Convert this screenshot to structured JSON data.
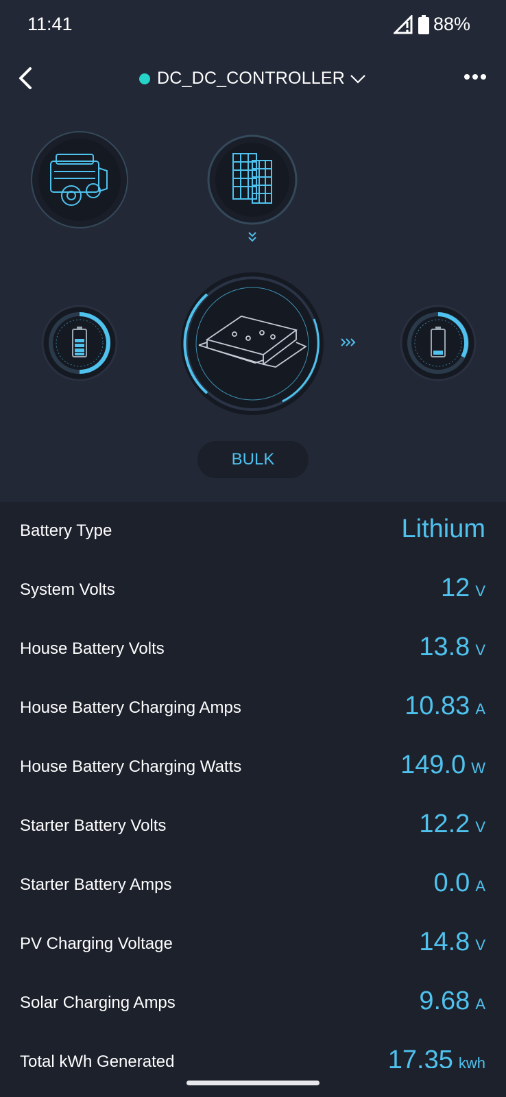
{
  "status_bar": {
    "time": "11:41",
    "battery": "88%"
  },
  "header": {
    "device_name": "DC_DC_CONTROLLER"
  },
  "mode": "BULK",
  "colors": {
    "accent": "#4fc2ee",
    "online_dot": "#26d3c8",
    "background": "#1d212c",
    "panel": "#232836"
  },
  "rows": [
    {
      "label": "Battery Type",
      "value": "Lithium",
      "unit": ""
    },
    {
      "label": "System Volts",
      "value": "12",
      "unit": "V"
    },
    {
      "label": "House Battery Volts",
      "value": "13.8",
      "unit": "V"
    },
    {
      "label": "House Battery Charging Amps",
      "value": "10.83",
      "unit": "A"
    },
    {
      "label": "House Battery Charging Watts",
      "value": "149.0",
      "unit": "W"
    },
    {
      "label": "Starter Battery Volts",
      "value": "12.2",
      "unit": "V"
    },
    {
      "label": "Starter Battery Amps",
      "value": "0.0",
      "unit": "A"
    },
    {
      "label": "PV Charging Voltage",
      "value": "14.8",
      "unit": "V"
    },
    {
      "label": "Solar Charging Amps",
      "value": "9.68",
      "unit": "A"
    },
    {
      "label": "Total kWh Generated",
      "value": "17.35",
      "unit": "kwh"
    }
  ]
}
